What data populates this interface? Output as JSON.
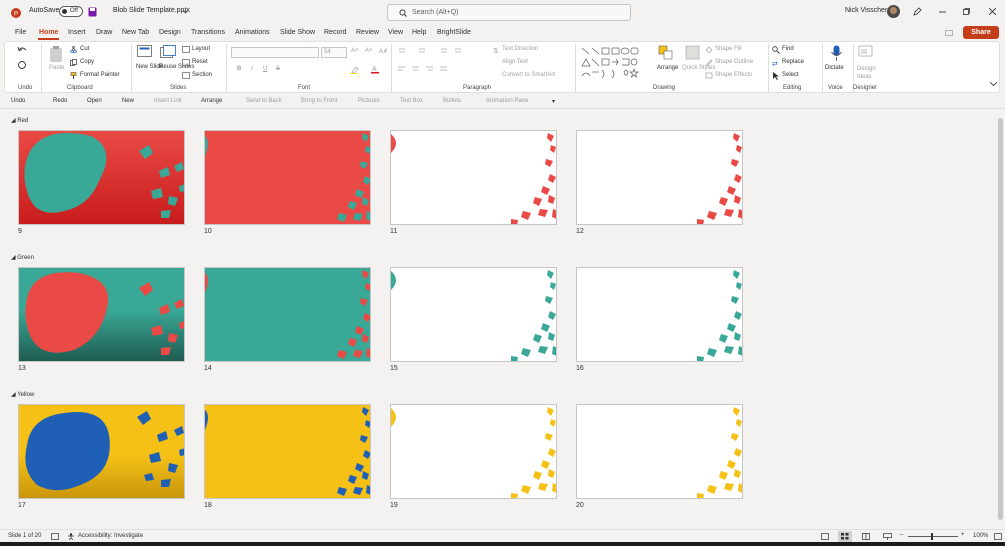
{
  "titlebar": {
    "autosave_label": "AutoSave",
    "autosave_state": "Off",
    "file_name": "Blob Slide Template.pptx",
    "search_placeholder": "Search (Alt+Q)",
    "user_name": "Nick Visscher",
    "accent": "#c43e1c"
  },
  "tabs": [
    {
      "label": "File"
    },
    {
      "label": "Home",
      "active": true
    },
    {
      "label": "Insert"
    },
    {
      "label": "Draw"
    },
    {
      "label": "New Tab"
    },
    {
      "label": "Design"
    },
    {
      "label": "Transitions"
    },
    {
      "label": "Animations"
    },
    {
      "label": "Slide Show"
    },
    {
      "label": "Record"
    },
    {
      "label": "Review"
    },
    {
      "label": "View"
    },
    {
      "label": "Help"
    },
    {
      "label": "BrightSlide"
    }
  ],
  "share_label": "Share",
  "ribbon": {
    "undo": {
      "group": "Undo"
    },
    "clipboard": {
      "paste": "Paste",
      "cut": "Cut",
      "copy": "Copy",
      "format_painter": "Format Painter",
      "group": "Clipboard"
    },
    "slides": {
      "new_slide": "New Slide",
      "reuse_slides": "Reuse Slides",
      "layout": "Layout",
      "reset": "Reset",
      "section": "Section",
      "group": "Slides"
    },
    "font": {
      "font_size": "54",
      "bold": "B",
      "italic": "I",
      "underline": "U",
      "strike": "S",
      "group": "Font"
    },
    "paragraph": {
      "text_direction": "Text Direction",
      "align_text": "Align Text",
      "convert_smartart": "Convert to SmartArt",
      "group": "Paragraph"
    },
    "drawing": {
      "arrange": "Arrange",
      "quick_styles": "Quick Styles",
      "shape_fill": "Shape Fill",
      "shape_outline": "Shape Outline",
      "shape_effects": "Shape Effects",
      "group": "Drawing"
    },
    "editing": {
      "find": "Find",
      "replace": "Replace",
      "select": "Select",
      "group": "Editing"
    },
    "voice": {
      "dictate": "Dictate",
      "group": "Voice"
    },
    "designer": {
      "design_ideas": "Design Ideas",
      "group": "Designer"
    }
  },
  "quick_access": {
    "undo": "Undo",
    "redo": "Redo",
    "open": "Open",
    "new": "New",
    "insert_link": "Insert Link",
    "arrange": "Arrange",
    "send_to_back": "Send to Back",
    "bring_to_front": "Bring to Front",
    "pictures": "Pictures",
    "text_box": "Text Box",
    "bullets": "Bullets",
    "animation_pane": "Animation Pane"
  },
  "sections": [
    {
      "name": "Red",
      "slides": [
        {
          "num": "9"
        },
        {
          "num": "10"
        },
        {
          "num": "11"
        },
        {
          "num": "12"
        }
      ]
    },
    {
      "name": "Green",
      "slides": [
        {
          "num": "13"
        },
        {
          "num": "14"
        },
        {
          "num": "15"
        },
        {
          "num": "16"
        }
      ]
    },
    {
      "name": "Yellow",
      "slides": [
        {
          "num": "17"
        },
        {
          "num": "18"
        },
        {
          "num": "19"
        },
        {
          "num": "20"
        }
      ]
    }
  ],
  "colors": {
    "red": "#ea4a45",
    "red_dark": "#c81d1d",
    "teal": "#3aa896",
    "teal_dark": "#1f5c52",
    "yellow": "#f5c116",
    "yellow_dark": "#c9960c",
    "blue": "#1f5fb5"
  },
  "status": {
    "slide_counter": "Slide 1 of 20",
    "accessibility": "Accessibility: Investigate",
    "zoom": "100%"
  }
}
